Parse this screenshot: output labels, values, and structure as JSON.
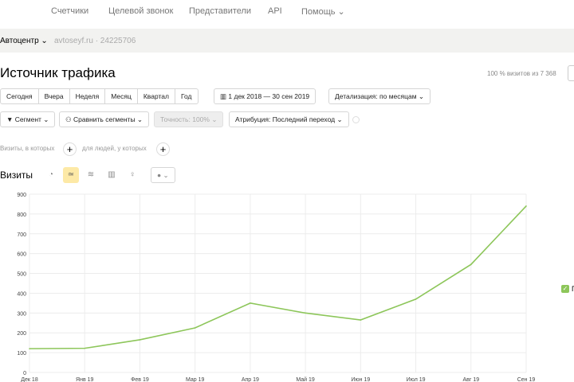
{
  "nav": {
    "items": [
      "Счетчики",
      "Целевой звонок",
      "Представители",
      "API",
      "Помощь ⌄"
    ]
  },
  "counter": {
    "name": "Автоцентр ⌄",
    "site": "avtoseyf.ru · 24225706"
  },
  "page": {
    "title": "Источник трафика",
    "visits_info": "100 % визитов из 7 368"
  },
  "periods": [
    "Сегодня",
    "Вчера",
    "Неделя",
    "Месяц",
    "Квартал",
    "Год"
  ],
  "date_range": "1 дек 2018 — 30 сен 2019",
  "detail": "Детализация: по месяцам ⌄",
  "segment": "Сегмент ⌄",
  "compare": "Сравнить сегменты ⌄",
  "accuracy": "Точность: 100% ⌄",
  "attribution": "Атрибуция: Последний переход ⌄",
  "filters": {
    "visits": "Визиты, в которых",
    "people": "для людей, у которых"
  },
  "chart_section": {
    "label": "Визиты"
  },
  "legend": {
    "label": "П"
  },
  "chart_data": {
    "type": "line",
    "categories": [
      "Дек 18",
      "Янв 19",
      "Фев 19",
      "Мар 19",
      "Апр 19",
      "Май 19",
      "Июн 19",
      "Июл 19",
      "Авг 19",
      "Сен 19"
    ],
    "series": [
      {
        "name": "П",
        "values": [
          120,
          122,
          165,
          225,
          350,
          300,
          265,
          370,
          545,
          840
        ],
        "color": "#8dc65a"
      }
    ],
    "ylim": [
      0,
      900
    ],
    "yticks": [
      0,
      100,
      200,
      300,
      400,
      500,
      600,
      700,
      800,
      900
    ],
    "grid": true
  }
}
